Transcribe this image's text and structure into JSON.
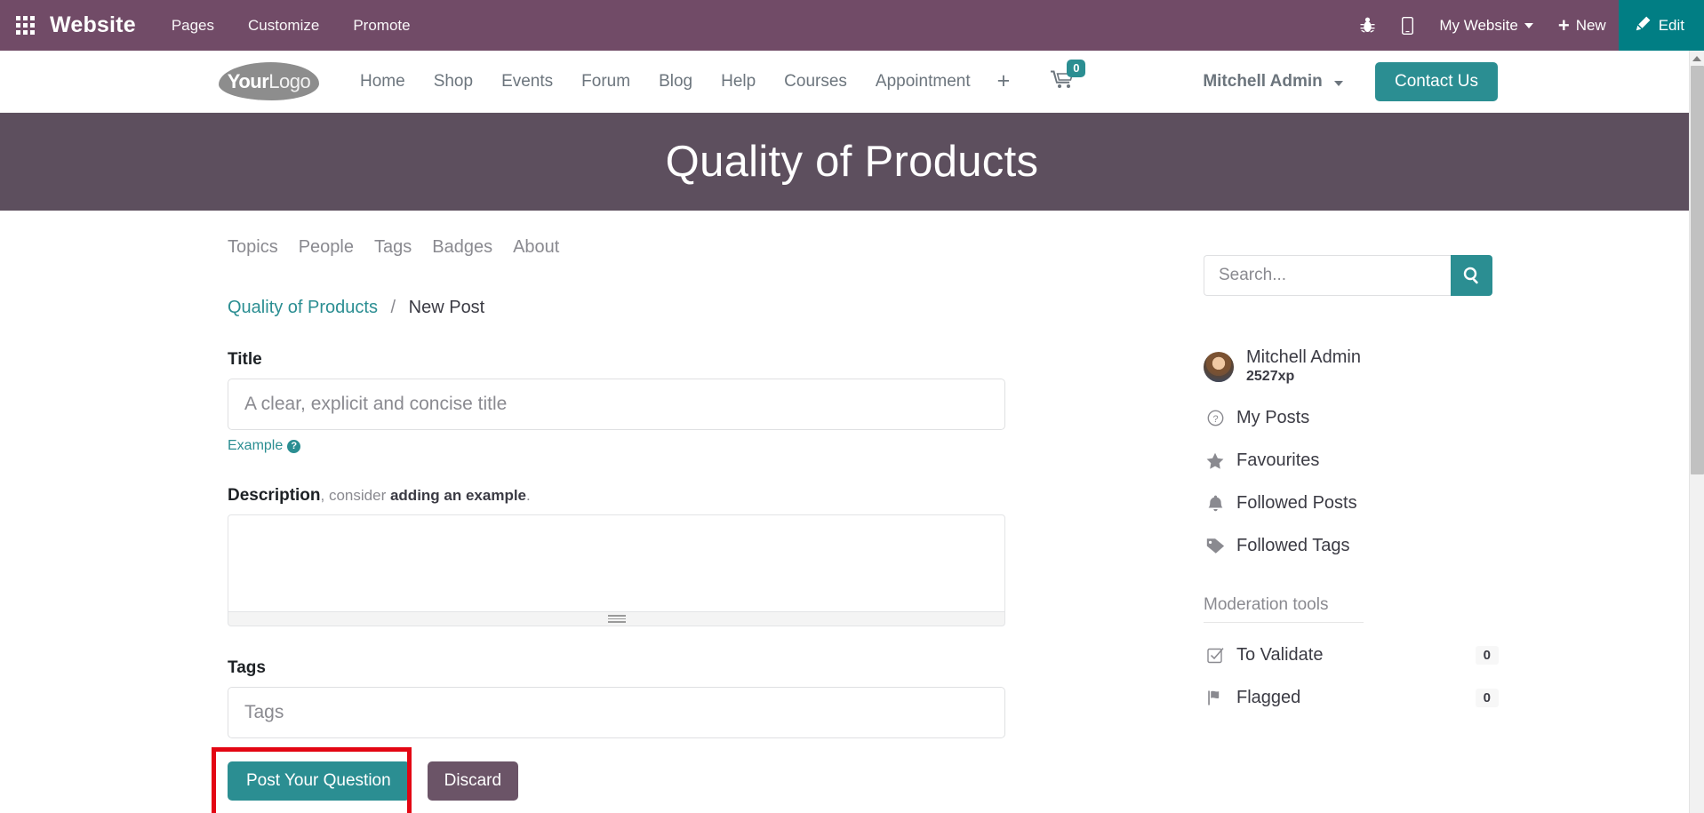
{
  "backend_bar": {
    "apps_icon": "apps-grid-icon",
    "brand": "Website",
    "menus": [
      "Pages",
      "Customize",
      "Promote"
    ],
    "bug_icon": "bug-icon",
    "mobile_icon": "mobile-preview-icon",
    "website_selector": "My Website",
    "new_label": "New",
    "new_icon": "plus-icon",
    "edit_label": "Edit",
    "edit_icon": "pencil-icon",
    "bg_color": "#714B67",
    "edit_color": "#017e84"
  },
  "site_header": {
    "logo_bold": "Your",
    "logo_light": "Logo",
    "nav": [
      "Home",
      "Shop",
      "Events",
      "Forum",
      "Blog",
      "Help",
      "Courses",
      "Appointment"
    ],
    "nav_plus": "+",
    "cart_icon": "shopping-cart-icon",
    "cart_count": "0",
    "user_name": "Mitchell Admin",
    "contact_label": "Contact Us",
    "accent_color": "#2b8e92"
  },
  "hero": {
    "title": "Quality of Products",
    "bg_color": "#5d4f5e"
  },
  "forum_tabs": [
    "Topics",
    "People",
    "Tags",
    "Badges",
    "About"
  ],
  "search": {
    "placeholder": "Search...",
    "icon": "search-icon",
    "value": ""
  },
  "breadcrumb": {
    "parent": "Quality of Products",
    "separator": "/",
    "current": "New Post"
  },
  "form": {
    "title_label": "Title",
    "title_placeholder": "A clear, explicit and concise title",
    "title_value": "",
    "example_link": "Example",
    "example_icon": "question-circle-icon",
    "description_label": "Description",
    "description_hint_light": ", consider ",
    "description_hint_bold": "adding an example",
    "description_hint_end": ".",
    "description_value": "",
    "tags_label": "Tags",
    "tags_placeholder": "Tags",
    "tags_value": "",
    "post_button": "Post Your Question",
    "discard_button": "Discard",
    "highlight_color": "#e30613"
  },
  "sidebar": {
    "profile": {
      "name": "Mitchell Admin",
      "xp": "2527xp",
      "avatar": "user-avatar"
    },
    "links": [
      {
        "label": "My Posts",
        "icon": "question-circle-icon",
        "count": null
      },
      {
        "label": "Favourites",
        "icon": "star-icon",
        "count": null
      },
      {
        "label": "Followed Posts",
        "icon": "bell-icon",
        "count": null
      },
      {
        "label": "Followed Tags",
        "icon": "tag-icon",
        "count": null
      }
    ],
    "moderation_heading": "Moderation tools",
    "moderation_links": [
      {
        "label": "To Validate",
        "icon": "check-square-icon",
        "count": "0"
      },
      {
        "label": "Flagged",
        "icon": "flag-icon",
        "count": "0"
      }
    ]
  }
}
